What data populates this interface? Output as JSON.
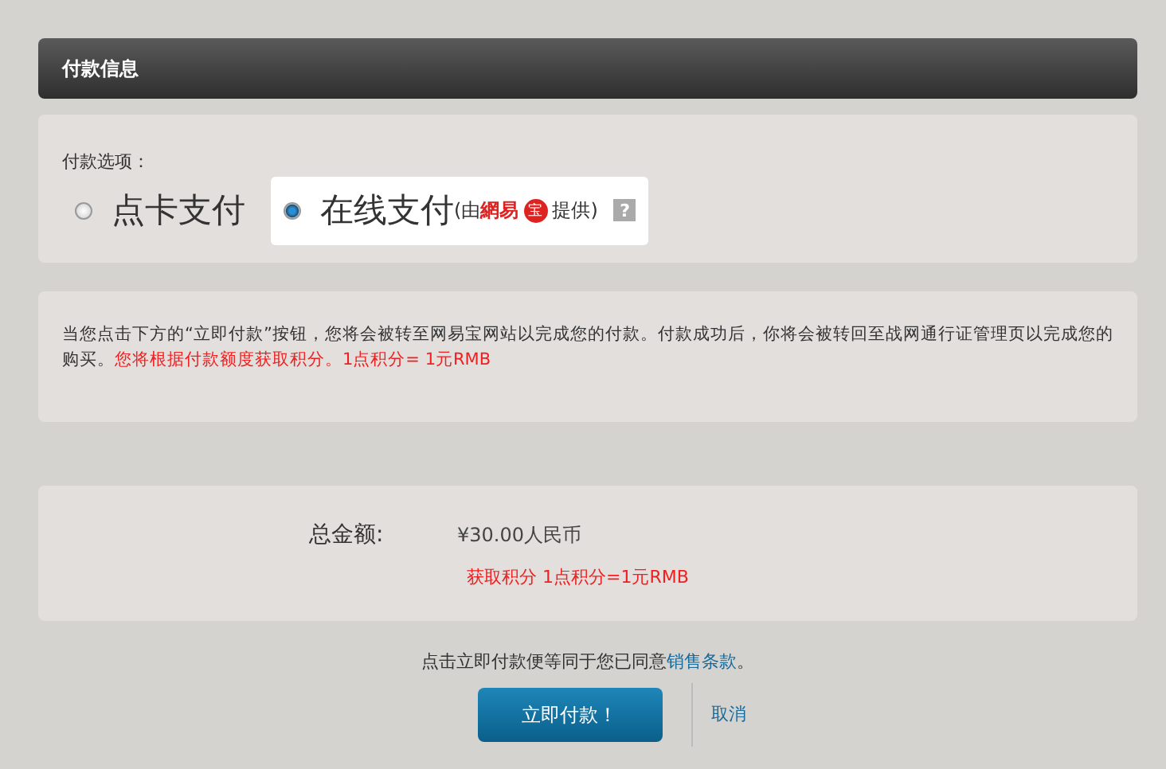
{
  "header": {
    "title": "付款信息"
  },
  "payment_options": {
    "label": "付款选项：",
    "options": [
      {
        "label": "点卡支付",
        "selected": false
      },
      {
        "label": "在线支付",
        "selected": true,
        "provider_open": "(由",
        "provider_name": "網易",
        "provider_badge": "宝",
        "provider_close": "提供)",
        "help": "?"
      }
    ]
  },
  "notice": {
    "text": "当您点击下方的“立即付款”按钮，您将会被转至网易宝网站以完成您的付款。付款成功后，你将会被转回至战网通行证管理页以完成您的购买。",
    "highlight": "您将根据付款额度获取积分。1点积分= 1元RMB"
  },
  "summary": {
    "label": "总金额:",
    "amount": "¥30.00人民币",
    "points": "获取积分 1点积分=1元RMB"
  },
  "agreement": {
    "text": "点击立即付款便等同于您已同意",
    "link": "销售条款",
    "end": "。"
  },
  "buttons": {
    "pay": "立即付款！",
    "cancel": "取消"
  }
}
